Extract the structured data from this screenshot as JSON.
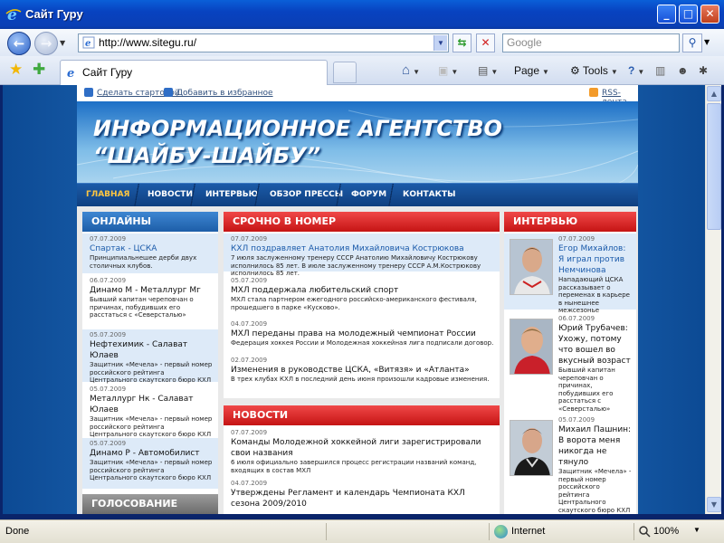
{
  "window": {
    "title": "Сайт Гуру"
  },
  "nav": {
    "address": "http://www.sitegu.ru/",
    "search_placeholder": "Google"
  },
  "tabs": {
    "active_label": "Сайт Гуру"
  },
  "toolbar": {
    "page": "Page",
    "tools": "Tools"
  },
  "site": {
    "topbar": {
      "make_home": "Сделать стартовой",
      "add_fav": "Добавить в избранное",
      "rss": "RSS-лента"
    },
    "banner": {
      "line1": "ИНФОРМАЦИОННОЕ АГЕНТСТВО",
      "line2": "“ШАЙБУ-ШАЙБУ”"
    },
    "menu": [
      "ГЛАВНАЯ",
      "НОВОСТИ",
      "ИНТЕРВЬЮ",
      "ОБЗОР ПРЕССЫ",
      "ФОРУМ",
      "КОНТАКТЫ"
    ],
    "online": {
      "header": "ОНЛАЙНЫ",
      "items": [
        {
          "date": "07.07.2009",
          "title": "Спартак - ЦСКА",
          "desc": "Принципиальнешее дерби двух столичных клубов."
        },
        {
          "date": "06.07.2009",
          "title": "Динамо М - Металлург Мг",
          "desc": "Бывший капитан череповчан о причинах, побудивших его расстаться с «Северсталью»"
        },
        {
          "date": "05.07.2009",
          "title": "Нефтехимик - Салават Юлаев",
          "desc": "Защитник «Мечела» - первый номер российского рейтинга Центрального скаутского бюро КХЛ"
        },
        {
          "date": "05.07.2009",
          "title": "Металлург Нк - Салават Юлаев",
          "desc": "Защитник «Мечела» - первый номер российского рейтинга Центрального скаутского бюро КХЛ"
        },
        {
          "date": "05.07.2009",
          "title": "Динамо Р - Автомобилист",
          "desc": "Защитник «Мечела» - первый номер российского рейтинга Центрального скаутского бюро КХЛ"
        }
      ],
      "vote_header": "ГОЛОСОВАНИЕ"
    },
    "urgent": {
      "header": "СРОЧНО В НОМЕР",
      "items": [
        {
          "date": "07.07.2009",
          "title": "КХЛ поздравляет Анатолия Михайловича Кострюкова",
          "desc": "7 июля заслуженному тренеру СССР Анатолию Михайловичу Кострюкову исполнилось 85 лет. В июле заслуженному тренеру СССР А.М.Кострюкову исполнилось 85 лет."
        },
        {
          "date": "05.07.2009",
          "title": "МХЛ поддержала любительский спорт",
          "desc": "МХЛ стала партнером ежегодного российско-американского фестиваля, прошедшего в парке «Кусково»."
        },
        {
          "date": "04.07.2009",
          "title": "МХЛ переданы права на молодежный чемпионат России",
          "desc": "Федерация хоккея России и Молодежная хоккейная лига подписали договор."
        },
        {
          "date": "02.07.2009",
          "title": "Изменения в руководстве ЦСКА, «Витязя» и «Атланта»",
          "desc": "В трех клубах КХЛ в последний день июня произошли кадровые изменения."
        }
      ]
    },
    "news": {
      "header": "НОВОСТИ",
      "items": [
        {
          "date": "07.07.2009",
          "title": "Команды Молодежной хоккейной лиги зарегистрировали свои названия",
          "desc": "6 июля официально завершился процесс регистрации названий команд, входящих в состав МХЛ"
        },
        {
          "date": "04.07.2009",
          "title": "Утверждены Регламент и календарь Чемпионата КХЛ сезона 2009/2010",
          "desc": ""
        }
      ]
    },
    "interview": {
      "header": "ИНТЕРВЬЮ",
      "items": [
        {
          "date": "07.07.2009",
          "title": "Егор Михайлов: Я играл против Немчинова",
          "desc": "Нападающий ЦСКА рассказывает о переменах в карьере в нынешнее межсезонье"
        },
        {
          "date": "06.07.2009",
          "title": "Юрий Трубачев: Ухожу, потому что вошел во вкусный возраст",
          "desc": "Бывший капитан череповчан о причинах, побудивших его расстаться с «Северсталью»"
        },
        {
          "date": "05.07.2009",
          "title": "Михаил Пашнин: В ворота меня никогда не тянуло",
          "desc": "Защитник «Мечела» - первый номер российского рейтинга Центрального скаутского бюро КХЛ"
        }
      ]
    }
  },
  "status": {
    "text": "Done",
    "zone": "Internet",
    "zoom": "100%"
  }
}
